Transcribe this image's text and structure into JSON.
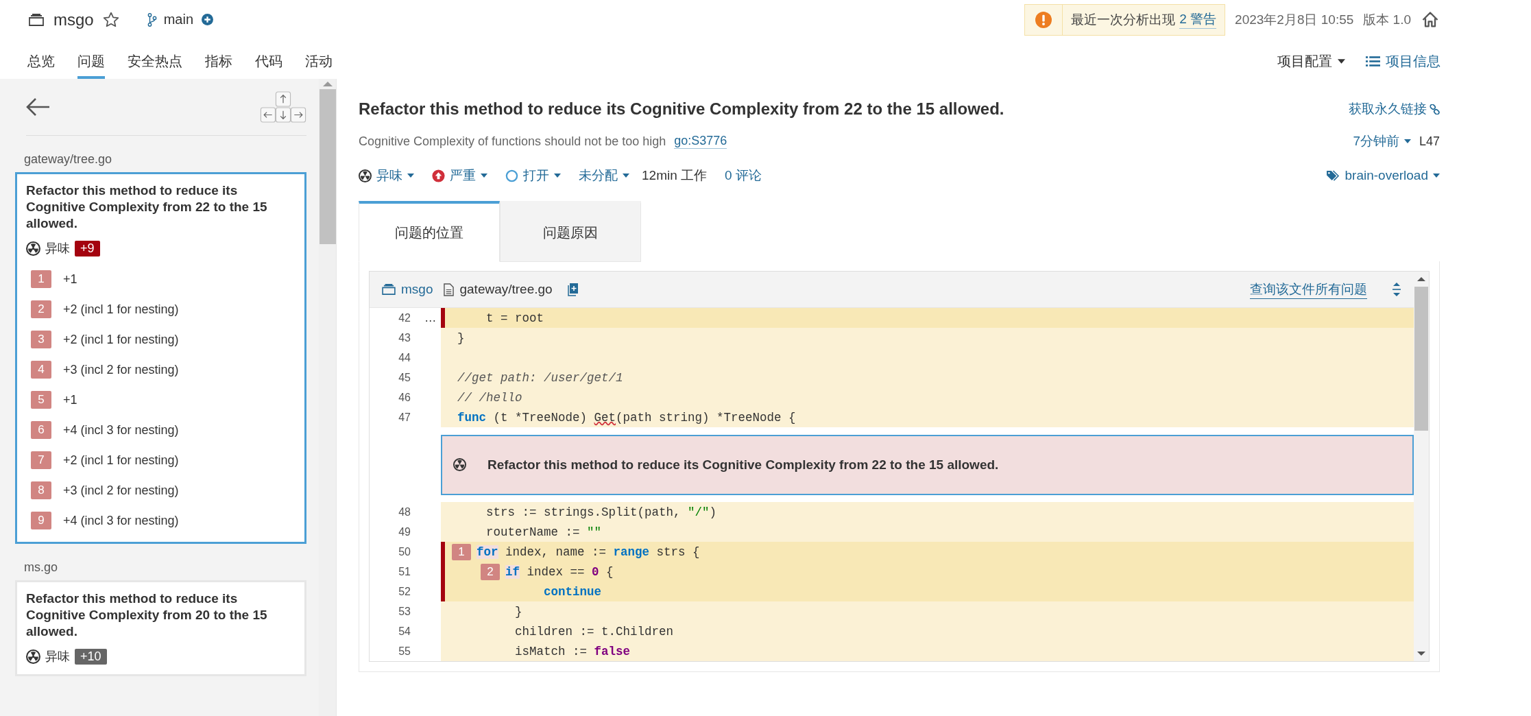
{
  "header": {
    "project": "msgo",
    "branch": "main",
    "alert": {
      "text": "最近一次分析出现",
      "link": "2 警告"
    },
    "date": "2023年2月8日 10:55",
    "version": "版本 1.0"
  },
  "nav": {
    "tabs": [
      {
        "label": "总览",
        "selected": false
      },
      {
        "label": "问题",
        "selected": true
      },
      {
        "label": "安全热点",
        "selected": false
      },
      {
        "label": "指标",
        "selected": false
      },
      {
        "label": "代码",
        "selected": false
      },
      {
        "label": "活动",
        "selected": false
      }
    ],
    "project_config": "项目配置",
    "project_info": "项目信息"
  },
  "sidebar": {
    "issues": [
      {
        "file": "gateway/tree.go",
        "title": "Refactor this method to reduce its Cognitive Complexity from 22 to the 15 allowed.",
        "type": "异味",
        "effort": "+9",
        "selected": true,
        "flows": [
          {
            "num": "1",
            "text": "+1"
          },
          {
            "num": "2",
            "text": "+2 (incl 1 for nesting)"
          },
          {
            "num": "3",
            "text": "+2 (incl 1 for nesting)"
          },
          {
            "num": "4",
            "text": "+3 (incl 2 for nesting)"
          },
          {
            "num": "5",
            "text": "+1"
          },
          {
            "num": "6",
            "text": "+4 (incl 3 for nesting)"
          },
          {
            "num": "7",
            "text": "+2 (incl 1 for nesting)"
          },
          {
            "num": "8",
            "text": "+3 (incl 2 for nesting)"
          },
          {
            "num": "9",
            "text": "+4 (incl 3 for nesting)"
          }
        ]
      },
      {
        "file": "ms.go",
        "title": "Refactor this method to reduce its Cognitive Complexity from 20 to the 15 allowed.",
        "type": "异味",
        "effort": "+10",
        "selected": false
      }
    ]
  },
  "issue": {
    "title": "Refactor this method to reduce its Cognitive Complexity from 22 to the 15 allowed.",
    "permalink": "获取永久链接",
    "rule_desc": "Cognitive Complexity of functions should not be too high",
    "rule_key": "go:S3776",
    "age": "7分钟前",
    "line": "L47",
    "type": "异味",
    "severity": "严重",
    "status": "打开",
    "assignee": "未分配",
    "effort": "12min 工作",
    "comments": "0 评论",
    "tag": "brain-overload"
  },
  "detail_tabs": [
    {
      "label": "问题的位置",
      "selected": true
    },
    {
      "label": "问题原因",
      "selected": false
    }
  ],
  "viewer": {
    "project": "msgo",
    "file": "gateway/tree.go",
    "all_issues_link": "查询该文件所有问题",
    "lines": [
      {
        "kind": "code",
        "number": "42",
        "gutter": "…",
        "highlighted": true,
        "tokens": [
          {
            "kind": "plain",
            "text": "    t = root"
          }
        ]
      },
      {
        "kind": "code",
        "number": "43",
        "highlighted": false,
        "tokens": [
          {
            "kind": "plain",
            "text": "}"
          }
        ]
      },
      {
        "kind": "code",
        "number": "44",
        "highlighted": false
      },
      {
        "kind": "code",
        "number": "45",
        "highlighted": false,
        "tokens": [
          {
            "kind": "comment",
            "text": "//get path: /user/get/1"
          }
        ]
      },
      {
        "kind": "code",
        "number": "46",
        "highlighted": false,
        "tokens": [
          {
            "kind": "comment",
            "text": "// /hello"
          }
        ]
      },
      {
        "kind": "code",
        "number": "47",
        "highlighted": false,
        "tokens": [
          {
            "kind": "keyword",
            "text": "func"
          },
          {
            "kind": "plain",
            "text": " (t *TreeNode) "
          },
          {
            "kind": "error",
            "text": "Get"
          },
          {
            "kind": "plain",
            "text": "(path string) *TreeNode {"
          }
        ]
      },
      {
        "kind": "issue",
        "text": "Refactor this method to reduce its Cognitive Complexity from 22 to the 15 allowed."
      },
      {
        "kind": "code",
        "number": "48",
        "highlighted": false,
        "tokens": [
          {
            "kind": "plain",
            "text": "    strs := strings.Split(path, "
          },
          {
            "kind": "string",
            "text": "\"/\""
          },
          {
            "kind": "plain",
            "text": ")"
          }
        ]
      },
      {
        "kind": "code",
        "number": "49",
        "highlighted": false,
        "tokens": [
          {
            "kind": "plain",
            "text": "    routerName := "
          },
          {
            "kind": "string",
            "text": "\"\""
          }
        ]
      },
      {
        "kind": "code",
        "number": "50",
        "highlighted": true,
        "tokens": [
          {
            "kind": "location",
            "text": "1"
          },
          {
            "kind": "marked",
            "text": "for"
          },
          {
            "kind": "plain",
            "text": " index, name := "
          },
          {
            "kind": "keyword",
            "text": "range"
          },
          {
            "kind": "plain",
            "text": " strs {"
          }
        ]
      },
      {
        "kind": "code",
        "number": "51",
        "highlighted": true,
        "nested": true,
        "tokens": [
          {
            "kind": "location",
            "text": "2"
          },
          {
            "kind": "marked",
            "text": "if"
          },
          {
            "kind": "plain",
            "text": " index == "
          },
          {
            "kind": "number",
            "text": "0"
          },
          {
            "kind": "plain",
            "text": " {"
          }
        ]
      },
      {
        "kind": "code",
        "number": "52",
        "highlighted": true,
        "tokens": [
          {
            "kind": "keyword",
            "text": "            continue"
          }
        ]
      },
      {
        "kind": "code",
        "number": "53",
        "highlighted": false,
        "tokens": [
          {
            "kind": "plain",
            "text": "        }"
          }
        ]
      },
      {
        "kind": "code",
        "number": "54",
        "highlighted": false,
        "tokens": [
          {
            "kind": "plain",
            "text": "        children := t.Children"
          }
        ]
      },
      {
        "kind": "code",
        "number": "55",
        "highlighted": false,
        "tokens": [
          {
            "kind": "plain",
            "text": "        isMatch := "
          },
          {
            "kind": "constant",
            "text": "false"
          }
        ]
      }
    ]
  }
}
